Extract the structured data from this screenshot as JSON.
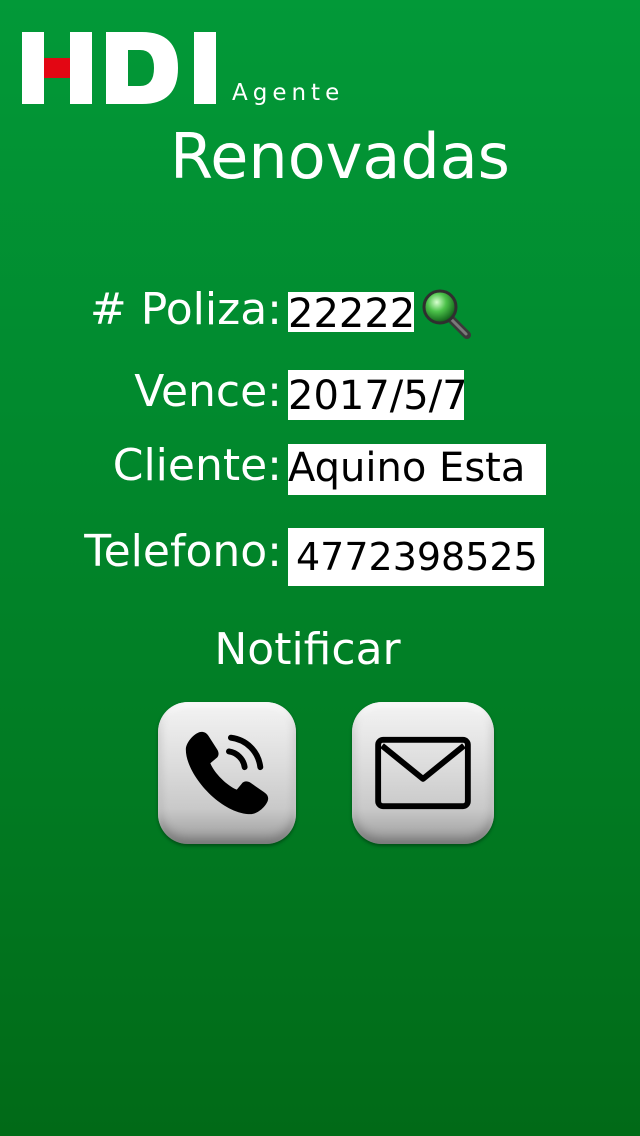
{
  "header": {
    "brand": "HDI",
    "brand_sub": "Agente",
    "title": "Renovadas"
  },
  "form": {
    "poliza": {
      "label": "# Poliza:",
      "value": "22222"
    },
    "vence": {
      "label": "Vence:",
      "value": "2017/5/7"
    },
    "cliente": {
      "label": "Cliente:",
      "value": "Aquino Esta"
    },
    "telefono": {
      "label": "Telefono:",
      "value": "4772398525"
    }
  },
  "notify": {
    "label": "Notificar",
    "actions": [
      {
        "name": "call",
        "icon": "phone-icon"
      },
      {
        "name": "email",
        "icon": "envelope-icon"
      }
    ]
  },
  "colors": {
    "background_top": "#029938",
    "background_bottom": "#016a17",
    "logo_accent": "#e30613"
  },
  "icons": {
    "search": "magnifier-icon"
  }
}
